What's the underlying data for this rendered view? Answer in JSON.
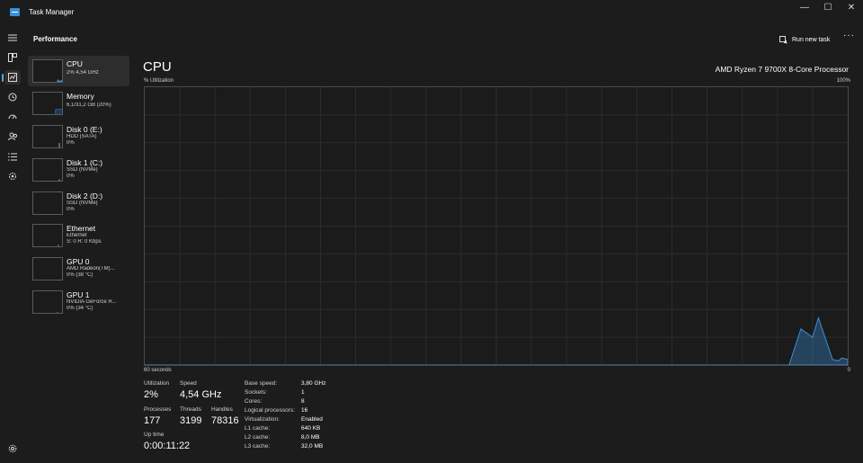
{
  "app": {
    "title": "Task Manager",
    "page_title": "Performance",
    "run_task_label": "Run new task",
    "more_label": "···"
  },
  "window_controls": {
    "minimize": "—",
    "maximize": "☐",
    "close": "✕"
  },
  "devices": [
    {
      "name": "CPU",
      "line1": "2% 4,54 GHz",
      "line2": ""
    },
    {
      "name": "Memory",
      "line1": "6,1/31,2 GB (20%)",
      "line2": ""
    },
    {
      "name": "Disk 0 (E:)",
      "line1": "HDD (SATA)",
      "line2": "0%"
    },
    {
      "name": "Disk 1 (C:)",
      "line1": "SSD (NVMe)",
      "line2": "0%"
    },
    {
      "name": "Disk 2 (D:)",
      "line1": "SSD (NVMe)",
      "line2": "0%"
    },
    {
      "name": "Ethernet",
      "line1": "Ethernet",
      "line2": "S: 0 R: 0 Kbps"
    },
    {
      "name": "GPU 0",
      "line1": "AMD Radeon(TM)...",
      "line2": "0% (38 °C)"
    },
    {
      "name": "GPU 1",
      "line1": "NVIDIA GeForce R...",
      "line2": "0% (34 °C)"
    }
  ],
  "main": {
    "title": "CPU",
    "processor": "AMD Ryzen 7 9700X 8-Core Processor",
    "util_label": "% Utilization",
    "max_label": "100%",
    "time_label": "60 seconds",
    "min_label": "0"
  },
  "stats": {
    "utilization_label": "Utilization",
    "utilization": "2%",
    "speed_label": "Speed",
    "speed": "4,54 GHz",
    "processes_label": "Processes",
    "processes": "177",
    "threads_label": "Threads",
    "threads": "3199",
    "handles_label": "Handles",
    "handles": "78316",
    "uptime_label": "Up time",
    "uptime": "0:00:11:22"
  },
  "specs": [
    {
      "label": "Base speed:",
      "value": "3,80 GHz"
    },
    {
      "label": "Sockets:",
      "value": "1"
    },
    {
      "label": "Cores:",
      "value": "8"
    },
    {
      "label": "Logical processors:",
      "value": "16"
    },
    {
      "label": "Virtualization:",
      "value": "Enabled"
    },
    {
      "label": "L1 cache:",
      "value": "640 KB"
    },
    {
      "label": "L2 cache:",
      "value": "8,0 MB"
    },
    {
      "label": "L3 cache:",
      "value": "32,0 MB"
    }
  ],
  "chart_data": {
    "type": "area",
    "x": [
      60,
      5,
      4,
      3,
      2.5,
      1.3,
      0.8,
      0.5,
      0
    ],
    "y": [
      0,
      0,
      13,
      10,
      17,
      2,
      1.5,
      2.5,
      2
    ],
    "ylim": [
      0,
      100
    ],
    "xlim": [
      60,
      0
    ],
    "grid": true,
    "color": "#3a8fd8"
  },
  "colors": {
    "accent": "#3a8fd8",
    "background": "#1c1c1c"
  }
}
